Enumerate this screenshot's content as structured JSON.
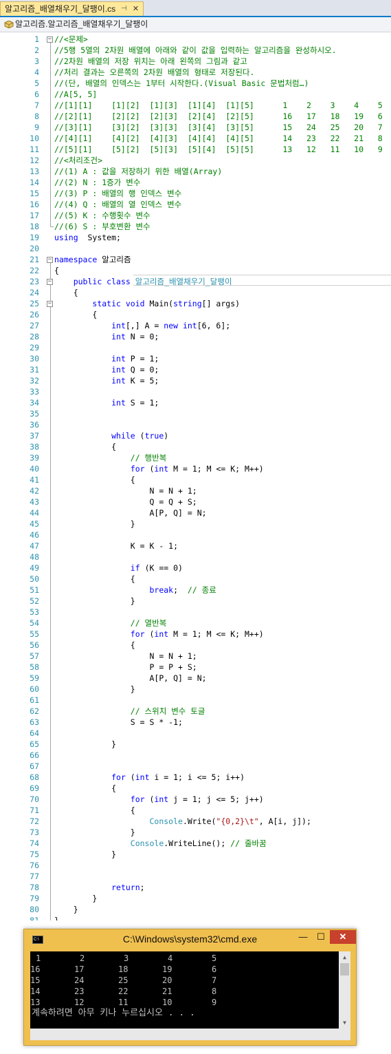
{
  "tab": {
    "title": "알고리즘_배열채우기_달팽이.cs",
    "pin": "⊣",
    "close": "✕"
  },
  "navbar": {
    "crumb": "알고리즘.알고리즘_배열채우기_달팽이"
  },
  "editor": {
    "lines": [
      {
        "n": "1",
        "t": [
          [
            "cm",
            "//<문제>"
          ]
        ]
      },
      {
        "n": "2",
        "t": [
          [
            "cm",
            "//5행 5열의 2차원 배열에 아래와 같이 값을 입력하는 알고리즘을 완성하시오."
          ]
        ]
      },
      {
        "n": "3",
        "t": [
          [
            "cm",
            "//2차원 배열의 저장 위치는 아래 왼쪽의 그림과 같고"
          ]
        ]
      },
      {
        "n": "4",
        "t": [
          [
            "cm",
            "//처리 결과는 오른쪽의 2차원 배열의 형태로 저장된다."
          ]
        ]
      },
      {
        "n": "5",
        "t": [
          [
            "cm",
            "//(단, 배열의 인덱스는 1부터 시작한다.(Visual Basic 문법처럼…)"
          ]
        ]
      },
      {
        "n": "6",
        "t": [
          [
            "cm",
            "//A[5, 5]"
          ]
        ]
      },
      {
        "n": "7",
        "t": [
          [
            "cm",
            "//[1][1]    [1][2]  [1][3]  [1][4]  [1][5]      1    2    3    4    5"
          ]
        ]
      },
      {
        "n": "8",
        "t": [
          [
            "cm",
            "//[2][1]    [2][2]  [2][3]  [2][4]  [2][5]      16   17   18   19   6"
          ]
        ]
      },
      {
        "n": "9",
        "t": [
          [
            "cm",
            "//[3][1]    [3][2]  [3][3]  [3][4]  [3][5]      15   24   25   20   7"
          ]
        ]
      },
      {
        "n": "10",
        "t": [
          [
            "cm",
            "//[4][1]    [4][2]  [4][3]  [4][4]  [4][5]      14   23   22   21   8"
          ]
        ]
      },
      {
        "n": "11",
        "t": [
          [
            "cm",
            "//[5][1]    [5][2]  [5][3]  [5][4]  [5][5]      13   12   11   10   9"
          ]
        ]
      },
      {
        "n": "12",
        "t": [
          [
            "cm",
            "//<처리조건>"
          ]
        ]
      },
      {
        "n": "13",
        "t": [
          [
            "cm",
            "//(1) A : 값을 저장하기 위한 배열(Array)"
          ]
        ]
      },
      {
        "n": "14",
        "t": [
          [
            "cm",
            "//(2) N : 1증가 변수"
          ]
        ]
      },
      {
        "n": "15",
        "t": [
          [
            "cm",
            "//(3) P : 배열의 행 인덱스 변수"
          ]
        ]
      },
      {
        "n": "16",
        "t": [
          [
            "cm",
            "//(4) Q : 배열의 열 인덱스 변수"
          ]
        ]
      },
      {
        "n": "17",
        "t": [
          [
            "cm",
            "//(5) K : 수행횟수 변수"
          ]
        ]
      },
      {
        "n": "18",
        "t": [
          [
            "cm",
            "//(6) S : 부호변환 변수"
          ]
        ]
      },
      {
        "n": "19",
        "t": [
          [
            "kw",
            "using"
          ],
          [
            "",
            "  System;"
          ]
        ]
      },
      {
        "n": "20",
        "t": []
      },
      {
        "n": "21",
        "t": [
          [
            "kw",
            "namespace"
          ],
          [
            "",
            " 알고리즘"
          ]
        ]
      },
      {
        "n": "22",
        "t": [
          [
            "",
            "{"
          ]
        ]
      },
      {
        "n": "23",
        "t": [
          [
            "",
            "    "
          ],
          [
            "kw",
            "public class"
          ],
          [
            "",
            " "
          ],
          [
            "ty",
            "알고리즘_배열채우기_달팽이"
          ]
        ]
      },
      {
        "n": "24",
        "t": [
          [
            "",
            "    {"
          ]
        ]
      },
      {
        "n": "25",
        "t": [
          [
            "",
            "        "
          ],
          [
            "kw",
            "static void"
          ],
          [
            "",
            " Main("
          ],
          [
            "kw",
            "string"
          ],
          [
            "",
            "[] args)"
          ]
        ]
      },
      {
        "n": "26",
        "t": [
          [
            "",
            "        {"
          ]
        ]
      },
      {
        "n": "27",
        "t": [
          [
            "",
            "            "
          ],
          [
            "kw",
            "int"
          ],
          [
            "",
            "[,] A = "
          ],
          [
            "kw",
            "new int"
          ],
          [
            "",
            "[6, 6];"
          ]
        ]
      },
      {
        "n": "28",
        "t": [
          [
            "",
            "            "
          ],
          [
            "kw",
            "int"
          ],
          [
            "",
            " N = 0;"
          ]
        ]
      },
      {
        "n": "29",
        "t": []
      },
      {
        "n": "30",
        "t": [
          [
            "",
            "            "
          ],
          [
            "kw",
            "int"
          ],
          [
            "",
            " P = 1;"
          ]
        ]
      },
      {
        "n": "31",
        "t": [
          [
            "",
            "            "
          ],
          [
            "kw",
            "int"
          ],
          [
            "",
            " Q = 0;"
          ]
        ]
      },
      {
        "n": "32",
        "t": [
          [
            "",
            "            "
          ],
          [
            "kw",
            "int"
          ],
          [
            "",
            " K = 5;"
          ]
        ]
      },
      {
        "n": "33",
        "t": []
      },
      {
        "n": "34",
        "t": [
          [
            "",
            "            "
          ],
          [
            "kw",
            "int"
          ],
          [
            "",
            " S = 1;"
          ]
        ]
      },
      {
        "n": "35",
        "t": []
      },
      {
        "n": "36",
        "t": []
      },
      {
        "n": "37",
        "t": [
          [
            "",
            "            "
          ],
          [
            "kw",
            "while"
          ],
          [
            "",
            " ("
          ],
          [
            "kw",
            "true"
          ],
          [
            "",
            ")"
          ]
        ]
      },
      {
        "n": "38",
        "t": [
          [
            "",
            "            {"
          ]
        ]
      },
      {
        "n": "39",
        "t": [
          [
            "",
            "                "
          ],
          [
            "cm",
            "// 행반복"
          ]
        ]
      },
      {
        "n": "40",
        "t": [
          [
            "",
            "                "
          ],
          [
            "kw",
            "for"
          ],
          [
            "",
            " ("
          ],
          [
            "kw",
            "int"
          ],
          [
            "",
            " M = 1; M <= K; M++)"
          ]
        ]
      },
      {
        "n": "41",
        "t": [
          [
            "",
            "                {"
          ]
        ]
      },
      {
        "n": "42",
        "t": [
          [
            "",
            "                    N = N + 1;"
          ]
        ]
      },
      {
        "n": "43",
        "t": [
          [
            "",
            "                    Q = Q + S;"
          ]
        ]
      },
      {
        "n": "44",
        "t": [
          [
            "",
            "                    A[P, Q] = N;"
          ]
        ]
      },
      {
        "n": "45",
        "t": [
          [
            "",
            "                }"
          ]
        ]
      },
      {
        "n": "46",
        "t": []
      },
      {
        "n": "47",
        "t": [
          [
            "",
            "                K = K - 1;"
          ]
        ]
      },
      {
        "n": "48",
        "t": []
      },
      {
        "n": "49",
        "t": [
          [
            "",
            "                "
          ],
          [
            "kw",
            "if"
          ],
          [
            "",
            " (K == 0)"
          ]
        ]
      },
      {
        "n": "50",
        "t": [
          [
            "",
            "                {"
          ]
        ]
      },
      {
        "n": "51",
        "t": [
          [
            "",
            "                    "
          ],
          [
            "kw",
            "break"
          ],
          [
            "",
            ";  "
          ],
          [
            "cm",
            "// 종료"
          ]
        ]
      },
      {
        "n": "52",
        "t": [
          [
            "",
            "                }"
          ]
        ]
      },
      {
        "n": "53",
        "t": []
      },
      {
        "n": "54",
        "t": [
          [
            "",
            "                "
          ],
          [
            "cm",
            "// 열반복"
          ]
        ]
      },
      {
        "n": "55",
        "t": [
          [
            "",
            "                "
          ],
          [
            "kw",
            "for"
          ],
          [
            "",
            " ("
          ],
          [
            "kw",
            "int"
          ],
          [
            "",
            " M = 1; M <= K; M++)"
          ]
        ]
      },
      {
        "n": "56",
        "t": [
          [
            "",
            "                {"
          ]
        ]
      },
      {
        "n": "57",
        "t": [
          [
            "",
            "                    N = N + 1;"
          ]
        ]
      },
      {
        "n": "58",
        "t": [
          [
            "",
            "                    P = P + S;"
          ]
        ]
      },
      {
        "n": "59",
        "t": [
          [
            "",
            "                    A[P, Q] = N;"
          ]
        ]
      },
      {
        "n": "60",
        "t": [
          [
            "",
            "                }"
          ]
        ]
      },
      {
        "n": "61",
        "t": []
      },
      {
        "n": "62",
        "t": [
          [
            "",
            "                "
          ],
          [
            "cm",
            "// 스위치 변수 토글"
          ]
        ]
      },
      {
        "n": "63",
        "t": [
          [
            "",
            "                S = S * -1;"
          ]
        ]
      },
      {
        "n": "64",
        "t": []
      },
      {
        "n": "65",
        "t": [
          [
            "",
            "            }"
          ]
        ]
      },
      {
        "n": "66",
        "t": []
      },
      {
        "n": "67",
        "t": []
      },
      {
        "n": "68",
        "t": [
          [
            "",
            "            "
          ],
          [
            "kw",
            "for"
          ],
          [
            "",
            " ("
          ],
          [
            "kw",
            "int"
          ],
          [
            "",
            " i = 1; i <= 5; i++)"
          ]
        ]
      },
      {
        "n": "69",
        "t": [
          [
            "",
            "            {"
          ]
        ]
      },
      {
        "n": "70",
        "t": [
          [
            "",
            "                "
          ],
          [
            "kw",
            "for"
          ],
          [
            "",
            " ("
          ],
          [
            "kw",
            "int"
          ],
          [
            "",
            " j = 1; j <= 5; j++)"
          ]
        ]
      },
      {
        "n": "71",
        "t": [
          [
            "",
            "                {"
          ]
        ]
      },
      {
        "n": "72",
        "t": [
          [
            "",
            "                    "
          ],
          [
            "ty",
            "Console"
          ],
          [
            "",
            ".Write("
          ],
          [
            "st",
            "\"{0,2}\\t\""
          ],
          [
            "",
            ", A[i, j]);"
          ]
        ]
      },
      {
        "n": "73",
        "t": [
          [
            "",
            "                }"
          ]
        ]
      },
      {
        "n": "74",
        "t": [
          [
            "",
            "                "
          ],
          [
            "ty",
            "Console"
          ],
          [
            "",
            ".WriteLine(); "
          ],
          [
            "cm",
            "// 줄바꿈"
          ]
        ]
      },
      {
        "n": "75",
        "t": [
          [
            "",
            "            }"
          ]
        ]
      },
      {
        "n": "76",
        "t": []
      },
      {
        "n": "77",
        "t": []
      },
      {
        "n": "78",
        "t": [
          [
            "",
            "            "
          ],
          [
            "kw",
            "return"
          ],
          [
            "",
            ";"
          ]
        ]
      },
      {
        "n": "79",
        "t": [
          [
            "",
            "        }"
          ]
        ]
      },
      {
        "n": "80",
        "t": [
          [
            "",
            "    }"
          ]
        ]
      },
      {
        "n": "81",
        "t": [
          [
            "",
            "}"
          ]
        ]
      }
    ]
  },
  "console": {
    "title": "C:\\Windows\\system32\\cmd.exe",
    "btn_min": "—",
    "btn_max": "☐",
    "btn_close": "✕",
    "icon_text": "C:\\",
    "rows": [
      [
        "1",
        "2",
        "3",
        "4",
        "5"
      ],
      [
        "16",
        "17",
        "18",
        "19",
        "6"
      ],
      [
        "15",
        "24",
        "25",
        "20",
        "7"
      ],
      [
        "14",
        "23",
        "22",
        "21",
        "8"
      ],
      [
        "13",
        "12",
        "11",
        "10",
        "9"
      ]
    ],
    "prompt": "계속하려면 아무 키나 누르십시오 . . ."
  },
  "colors": {
    "keyword": "#0000ff",
    "comment": "#008000",
    "type": "#2b91af",
    "string": "#a31515",
    "line_number": "#2b91af"
  }
}
